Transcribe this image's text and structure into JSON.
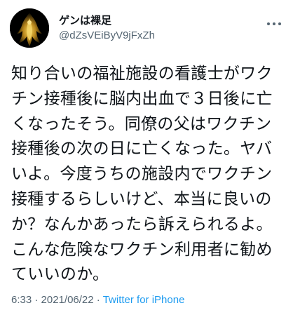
{
  "tweet": {
    "author": {
      "display_name": "ゲンは裸足",
      "handle": "@dZsVEiByV9jFxZh"
    },
    "text_lines": [
      "知り合いの福祉施設の看護士がワク",
      "チン接種後に脳内出血で３日後に亡",
      "くなったそう。同僚の父はワクチン",
      "接種後の次の日に亡くなった。ヤバ",
      "いよ。今度うちの施設内でワクチン",
      "接種するらしいけど、本当に良いの",
      "か？なんかあったら訴えられるよ。",
      "こんな危険なワクチン利用者に勧め",
      "ていいのか。"
    ],
    "time": "6:33",
    "separator": "·",
    "date": "2021/06/22",
    "source": "Twitter for iPhone"
  },
  "colors": {
    "text": "#0f1419",
    "secondary": "#536471",
    "link": "#1d9bf0",
    "avatar_bg": "#000000",
    "avatar_figure": "#e8c03a"
  },
  "icons": {
    "avatar": "avatar-golden-figure",
    "more": "more-horizontal-icon"
  }
}
